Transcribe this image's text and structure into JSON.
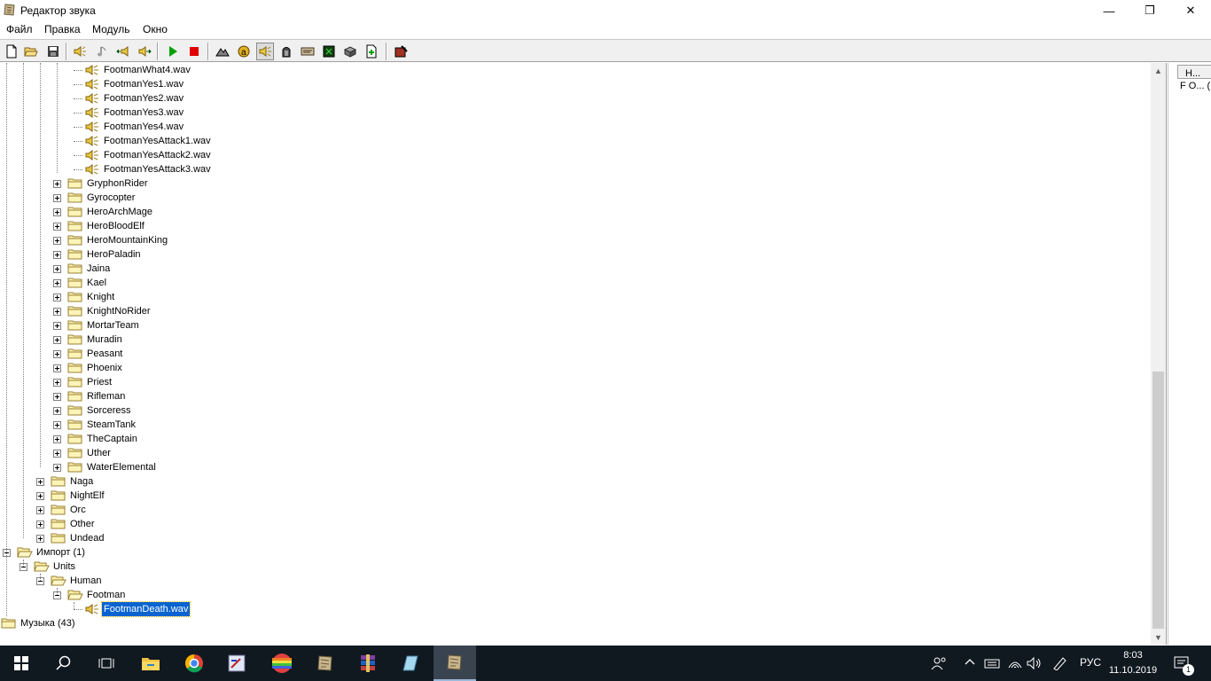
{
  "window": {
    "title": "Редактор звука",
    "minimize_glyph": "—",
    "maximize_glyph": "❐",
    "close_glyph": "✕"
  },
  "menu": {
    "items": [
      "Файл",
      "Правка",
      "Модуль",
      "Окно"
    ]
  },
  "toolbar": {
    "buttons": [
      {
        "icon": "new-file-icon"
      },
      {
        "icon": "open-folder-icon"
      },
      {
        "icon": "save-icon"
      },
      {
        "icon": "speaker-icon"
      },
      {
        "icon": "music-note-icon"
      },
      {
        "icon": "speaker-left-icon"
      },
      {
        "icon": "speaker-right-icon"
      },
      {
        "icon": "play-icon",
        "color": "#00a000"
      },
      {
        "icon": "stop-icon",
        "color": "#e00000"
      },
      {
        "icon": "terrain-editor-icon"
      },
      {
        "icon": "trigger-editor-icon"
      },
      {
        "icon": "sound-editor-icon",
        "pressed": true
      },
      {
        "icon": "object-editor-icon"
      },
      {
        "icon": "campaign-editor-icon"
      },
      {
        "icon": "ai-editor-icon"
      },
      {
        "icon": "object-manager-icon"
      },
      {
        "icon": "import-manager-icon"
      },
      {
        "icon": "test-map-icon"
      }
    ]
  },
  "tree": {
    "rows": [
      {
        "level": 5,
        "type": "sound",
        "label": "FootmanWhat4.wav"
      },
      {
        "level": 5,
        "type": "sound",
        "label": "FootmanYes1.wav"
      },
      {
        "level": 5,
        "type": "sound",
        "label": "FootmanYes2.wav"
      },
      {
        "level": 5,
        "type": "sound",
        "label": "FootmanYes3.wav"
      },
      {
        "level": 5,
        "type": "sound",
        "label": "FootmanYes4.wav"
      },
      {
        "level": 5,
        "type": "sound",
        "label": "FootmanYesAttack1.wav"
      },
      {
        "level": 5,
        "type": "sound",
        "label": "FootmanYesAttack2.wav"
      },
      {
        "level": 5,
        "type": "sound",
        "label": "FootmanYesAttack3.wav"
      },
      {
        "level": 4,
        "type": "folder",
        "exp": "plus",
        "label": "GryphonRider"
      },
      {
        "level": 4,
        "type": "folder",
        "exp": "plus",
        "label": "Gyrocopter"
      },
      {
        "level": 4,
        "type": "folder",
        "exp": "plus",
        "label": "HeroArchMage"
      },
      {
        "level": 4,
        "type": "folder",
        "exp": "plus",
        "label": "HeroBloodElf"
      },
      {
        "level": 4,
        "type": "folder",
        "exp": "plus",
        "label": "HeroMountainKing"
      },
      {
        "level": 4,
        "type": "folder",
        "exp": "plus",
        "label": "HeroPaladin"
      },
      {
        "level": 4,
        "type": "folder",
        "exp": "plus",
        "label": "Jaina"
      },
      {
        "level": 4,
        "type": "folder",
        "exp": "plus",
        "label": "Kael"
      },
      {
        "level": 4,
        "type": "folder",
        "exp": "plus",
        "label": "Knight"
      },
      {
        "level": 4,
        "type": "folder",
        "exp": "plus",
        "label": "KnightNoRider"
      },
      {
        "level": 4,
        "type": "folder",
        "exp": "plus",
        "label": "MortarTeam"
      },
      {
        "level": 4,
        "type": "folder",
        "exp": "plus",
        "label": "Muradin"
      },
      {
        "level": 4,
        "type": "folder",
        "exp": "plus",
        "label": "Peasant"
      },
      {
        "level": 4,
        "type": "folder",
        "exp": "plus",
        "label": "Phoenix"
      },
      {
        "level": 4,
        "type": "folder",
        "exp": "plus",
        "label": "Priest"
      },
      {
        "level": 4,
        "type": "folder",
        "exp": "plus",
        "label": "Rifleman"
      },
      {
        "level": 4,
        "type": "folder",
        "exp": "plus",
        "label": "Sorceress"
      },
      {
        "level": 4,
        "type": "folder",
        "exp": "plus",
        "label": "SteamTank"
      },
      {
        "level": 4,
        "type": "folder",
        "exp": "plus",
        "label": "TheCaptain"
      },
      {
        "level": 4,
        "type": "folder",
        "exp": "plus",
        "label": "Uther"
      },
      {
        "level": 4,
        "type": "folder",
        "exp": "plus",
        "label": "WaterElemental"
      },
      {
        "level": 3,
        "type": "folder",
        "exp": "plus",
        "label": "Naga"
      },
      {
        "level": 3,
        "type": "folder",
        "exp": "plus",
        "label": "NightElf"
      },
      {
        "level": 3,
        "type": "folder",
        "exp": "plus",
        "label": "Orc"
      },
      {
        "level": 3,
        "type": "folder",
        "exp": "plus",
        "label": "Other"
      },
      {
        "level": 3,
        "type": "folder",
        "exp": "plus",
        "label": "Undead"
      },
      {
        "level": 1,
        "type": "openfolder",
        "exp": "minus",
        "label": "Импорт (1)"
      },
      {
        "level": 2,
        "type": "openfolder",
        "exp": "minus",
        "label": "Units"
      },
      {
        "level": 3,
        "type": "openfolder",
        "exp": "minus",
        "label": "Human"
      },
      {
        "level": 4,
        "type": "openfolder",
        "exp": "minus",
        "label": "Footman"
      },
      {
        "level": 5,
        "type": "sound",
        "label": "FootmanDeath.wav",
        "selected": true
      },
      {
        "level": 1,
        "type": "folder",
        "exp": "none",
        "label": "Музыка (43)"
      }
    ]
  },
  "right_panel": {
    "header": "Н...",
    "cell": "F O...  ("
  },
  "taskbar": {
    "apps": [
      {
        "icon": "windows-start-icon"
      },
      {
        "icon": "search-icon"
      },
      {
        "icon": "task-view-icon"
      },
      {
        "icon": "file-explorer-icon"
      },
      {
        "icon": "chrome-icon"
      },
      {
        "icon": "paint-icon"
      },
      {
        "icon": "rainbow-app-icon"
      },
      {
        "icon": "world-editor-icon"
      },
      {
        "icon": "winrar-icon"
      },
      {
        "icon": "notepad-icon"
      },
      {
        "icon": "sound-editor-task-icon",
        "active": true
      }
    ],
    "tray": {
      "language": "РУС",
      "time": "8:03",
      "date": "11.10.2019",
      "notifications": "1"
    }
  }
}
